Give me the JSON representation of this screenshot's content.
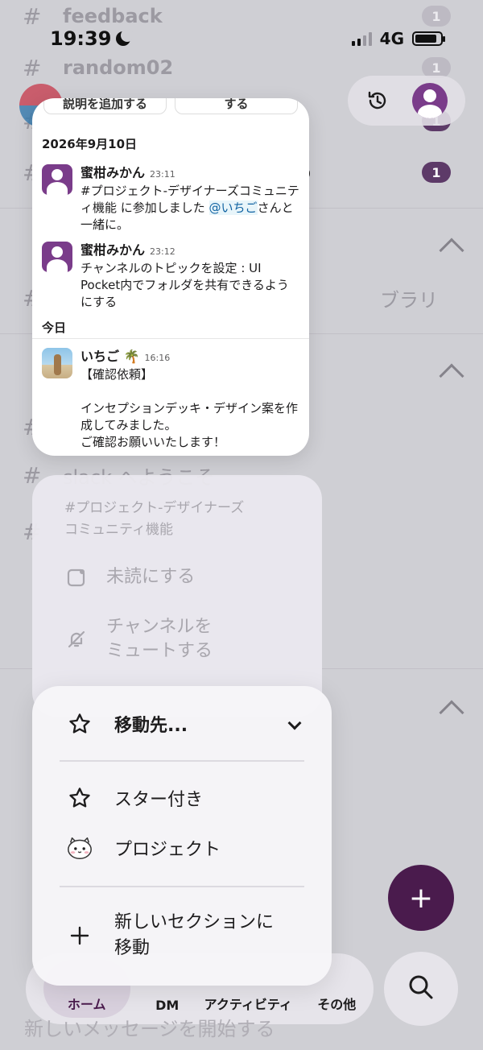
{
  "status_bar": {
    "time": "19:39",
    "network": "4G"
  },
  "background": {
    "channels": [
      {
        "hash": "#",
        "name": "feedback",
        "badge": "1"
      },
      {
        "hash": "#",
        "name": "random02",
        "badge": "1"
      },
      {
        "hash": "#",
        "name": "",
        "badge": "1"
      },
      {
        "hash": "#",
        "name": "p",
        "badge": "1"
      },
      {
        "hash": "#",
        "name": "ブラリ",
        "badge": ""
      },
      {
        "hash": "#",
        "name": "",
        "badge": ""
      },
      {
        "hash": "#",
        "name": "slack へようこそ",
        "badge": ""
      },
      {
        "hash": "#",
        "name": "",
        "badge": ""
      }
    ],
    "new_message_text": "新しいメッセージを開始する"
  },
  "preview": {
    "top_buttons": [
      "説明を追加する",
      "する"
    ],
    "date_1": "2026年9月10日",
    "messages_1": [
      {
        "name": "蜜柑みかん",
        "time": "23:11",
        "text_before": "#プロジェクト-デザイナーズコミュニティ機能 に参加しました ",
        "mention": "@いちご",
        "text_after": "さんと一緒に。"
      },
      {
        "name": "蜜柑みかん",
        "time": "23:12",
        "text": "チャンネルのトピックを設定 : UI Pocket内でフォルダを共有できるようにする"
      }
    ],
    "date_2": "今日",
    "message_today": {
      "name": "いちご 🌴",
      "time": "16:16",
      "line1": "【確認依頼】",
      "line2": "インセプションデッキ・デザイン案を作成してみました。",
      "line3": "ご確認お願いいたします！"
    }
  },
  "menu_top": {
    "channel_name_line1": "#プロジェクト-デザイナーズ",
    "channel_name_line2": "コミュニティ機能",
    "mark_unread": "未読にする",
    "mute_line1": "チャンネルを",
    "mute_line2": "ミュートする"
  },
  "menu_bottom": {
    "move_to": "移動先...",
    "starred": "スター付き",
    "project": "プロジェクト",
    "new_section_line1": "新しいセクションに",
    "new_section_line2": "移動"
  },
  "bottom_nav": {
    "home": "ホーム",
    "dm": "DM",
    "activity": "アクティビティ",
    "more": "その他"
  },
  "fab_label": "+",
  "colors": {
    "aubergine": "#4a1b4d",
    "avatar_purple": "#7a3c8a",
    "mention_blue": "#1264a3"
  }
}
